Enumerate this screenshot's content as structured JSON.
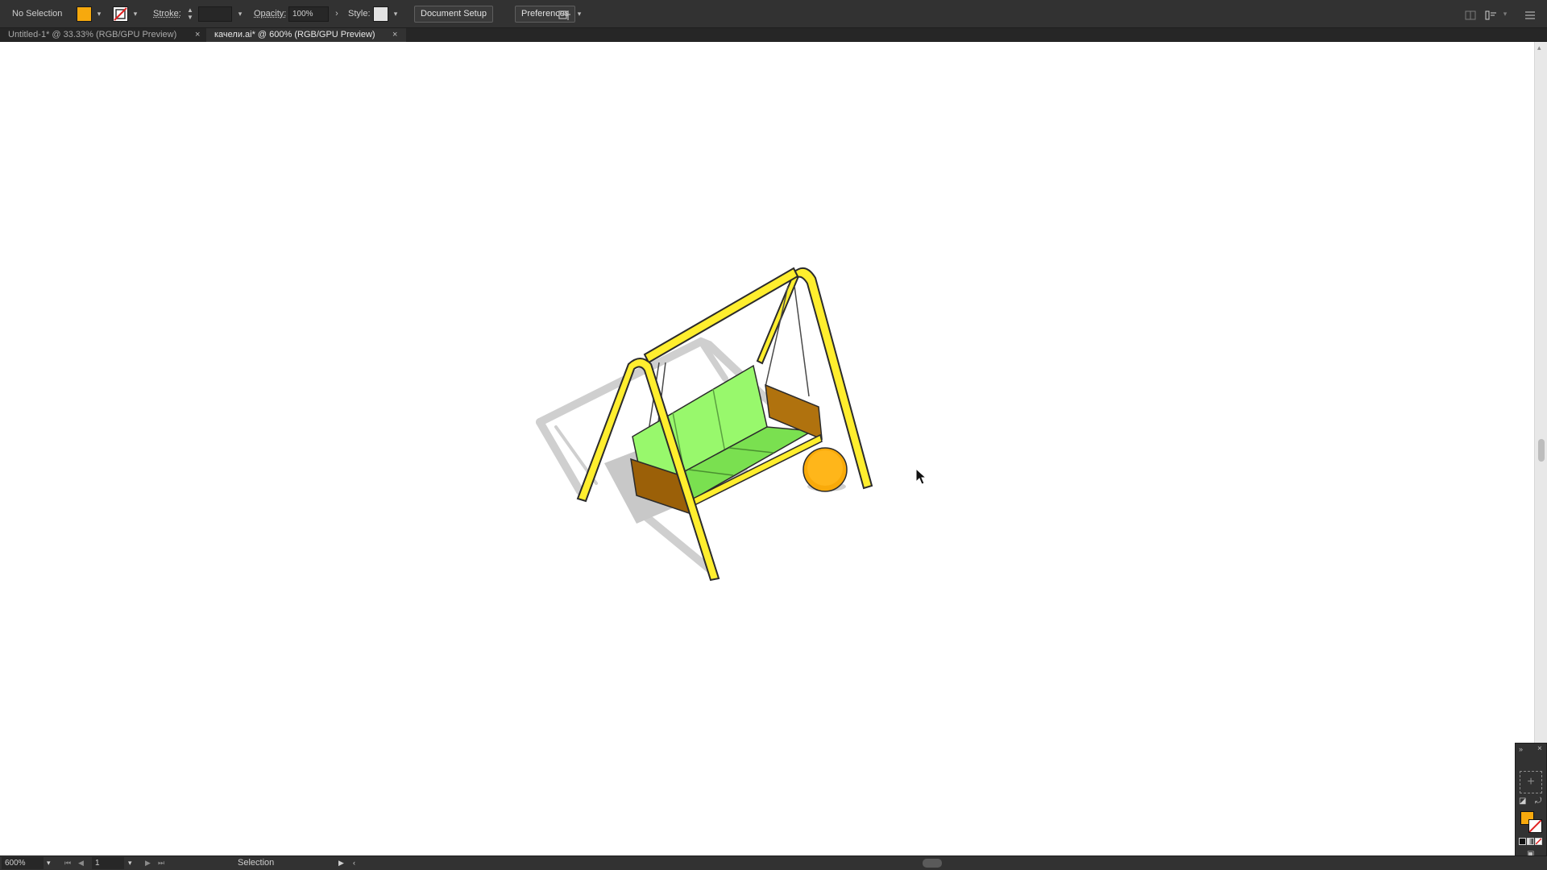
{
  "control_bar": {
    "selection_status": "No Selection",
    "stroke_label": "Stroke:",
    "opacity_label": "Opacity:",
    "opacity_value": "100%",
    "style_label": "Style:",
    "document_setup_label": "Document Setup",
    "preferences_label": "Preferences"
  },
  "tabs": [
    {
      "label": "Untitled-1* @ 33.33% (RGB/GPU Preview)",
      "close": "×"
    },
    {
      "label": "качели.ai* @ 600% (RGB/GPU Preview)",
      "close": "×"
    }
  ],
  "status_bar": {
    "zoom_value": "600%",
    "artboard_value": "1",
    "tool_name": "Selection"
  },
  "colors": {
    "fill": "#f7a90d",
    "frame_yellow": "#ffee2e",
    "seat_green": "#88f060",
    "wood_brown": "#b0720e",
    "ball_orange": "#f9aa0a",
    "shadow_gray": "#cfcfcf",
    "ui_dark": "#323232"
  },
  "icons": {
    "arrange": "arrange-documents-icon",
    "panel_menu": "panel-menu-icon",
    "cursor": "arrow-cursor-icon"
  }
}
